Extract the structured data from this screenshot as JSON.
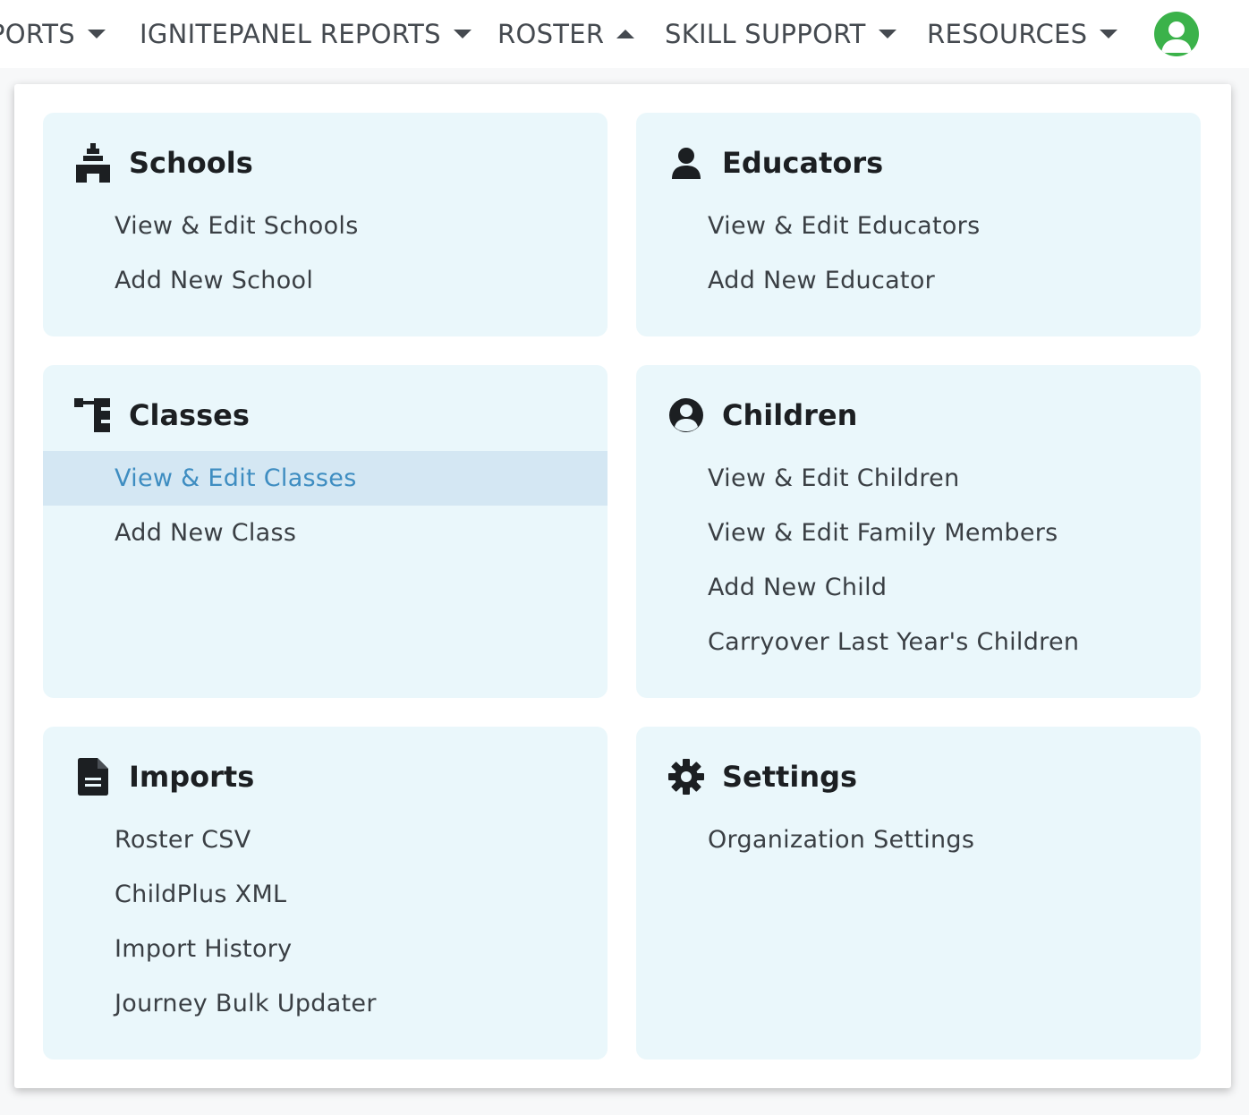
{
  "topnav": {
    "items": [
      {
        "label": "PORTS",
        "caret": "down"
      },
      {
        "label": "IGNITEPANEL REPORTS",
        "caret": "down"
      },
      {
        "label": "ROSTER",
        "caret": "up"
      },
      {
        "label": "SKILL SUPPORT",
        "caret": "down"
      },
      {
        "label": "RESOURCES",
        "caret": "down"
      }
    ],
    "avatar_icon": "user-avatar-icon"
  },
  "menu": {
    "schools": {
      "title": "Schools",
      "icon": "school-building-icon",
      "links": [
        "View & Edit Schools",
        "Add New School"
      ]
    },
    "educators": {
      "title": "Educators",
      "icon": "person-icon",
      "links": [
        "View & Edit Educators",
        "Add New Educator"
      ]
    },
    "classes": {
      "title": "Classes",
      "icon": "hierarchy-icon",
      "links": [
        "View & Edit Classes",
        "Add New Class"
      ],
      "active_index": 0
    },
    "children": {
      "title": "Children",
      "icon": "user-circle-icon",
      "links": [
        "View & Edit Children",
        "View & Edit Family Members",
        "Add New Child",
        "Carryover Last Year's Children"
      ]
    },
    "imports": {
      "title": "Imports",
      "icon": "document-icon",
      "links": [
        "Roster CSV",
        "ChildPlus XML",
        "Import History",
        "Journey Bulk Updater"
      ]
    },
    "settings": {
      "title": "Settings",
      "icon": "gear-icon",
      "links": [
        "Organization Settings"
      ]
    }
  },
  "colors": {
    "card_bg": "#eaf7fb",
    "active_bg": "#d4e7f3",
    "active_text": "#3e8dc1",
    "avatar": "#3bb24a"
  }
}
